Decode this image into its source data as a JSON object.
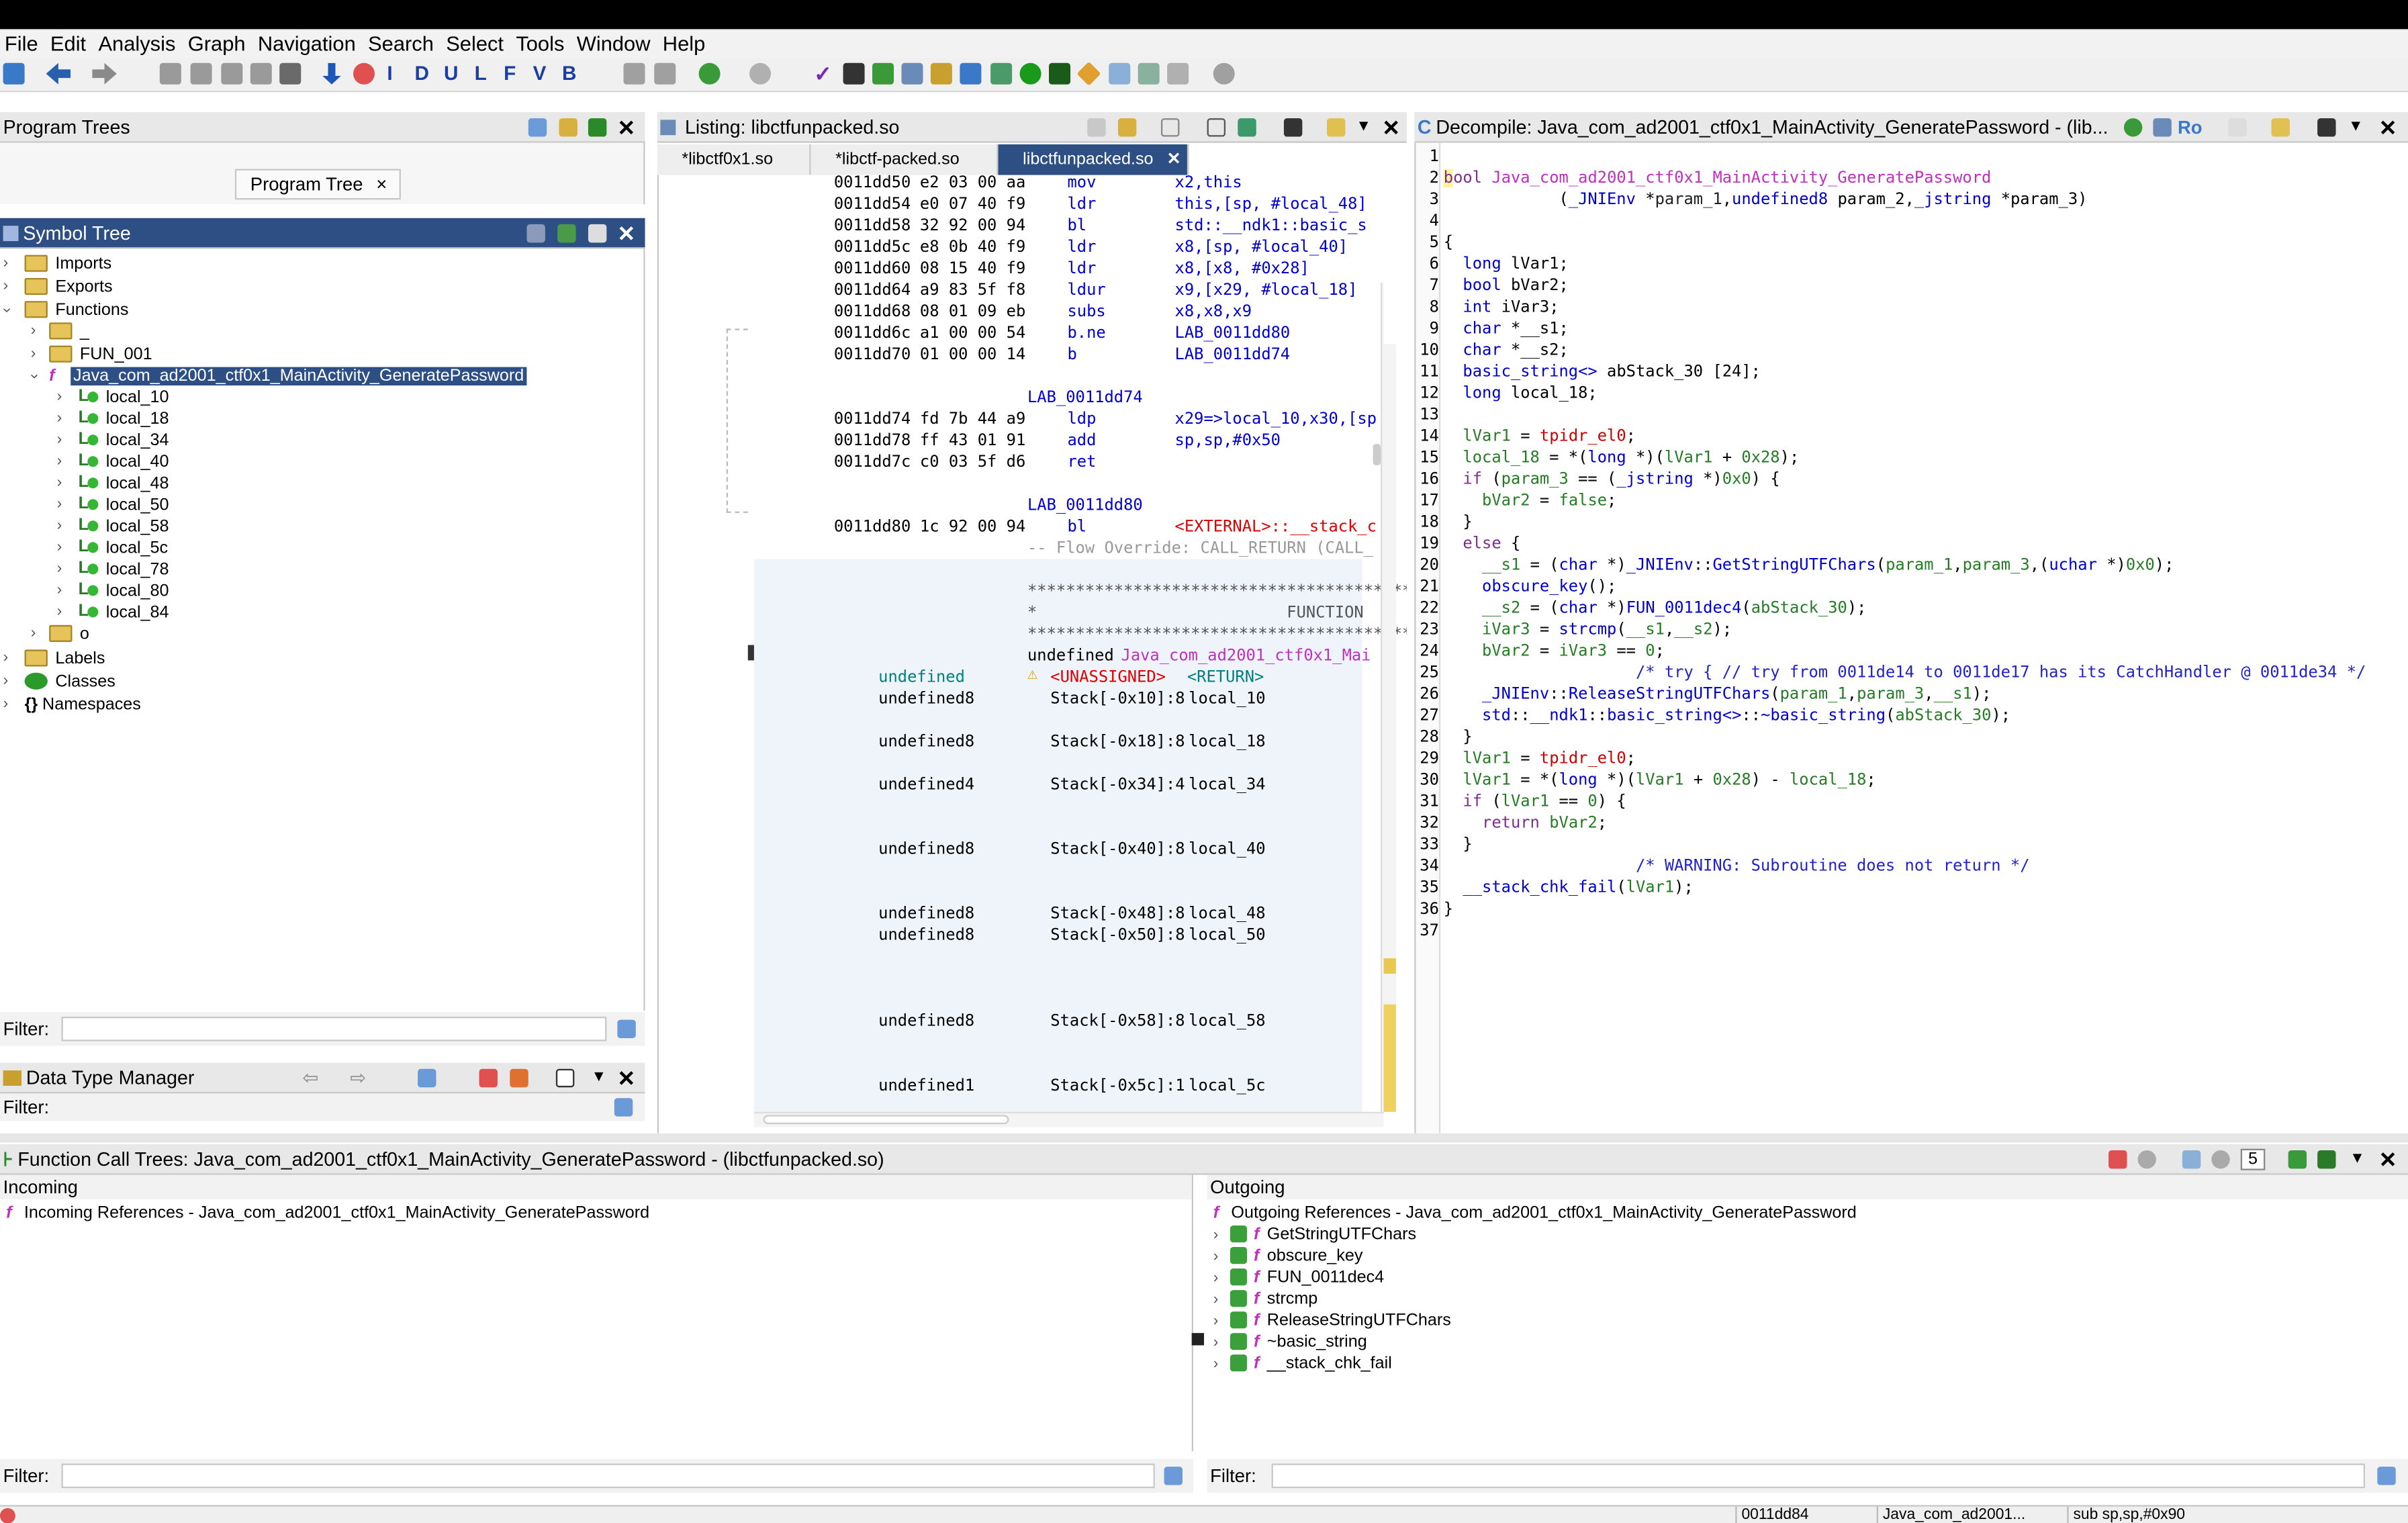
{
  "menu": [
    "File",
    "Edit",
    "Analysis",
    "Graph",
    "Navigation",
    "Search",
    "Select",
    "Tools",
    "Window",
    "Help"
  ],
  "program_trees": {
    "title": "Program Trees",
    "tab": "Program Tree",
    "close_glyph": "×"
  },
  "symbol_tree": {
    "title": "Symbol Tree",
    "imports": "Imports",
    "exports": "Exports",
    "functions": "Functions",
    "underscore": "_",
    "fun001": "FUN_001",
    "selected_function": "Java_com_ad2001_ctf0x1_MainActivity_GeneratePassword",
    "locals": [
      "local_10",
      "local_18",
      "local_34",
      "local_40",
      "local_48",
      "local_50",
      "local_58",
      "local_5c",
      "local_78",
      "local_80",
      "local_84"
    ],
    "o_node": "o",
    "labels": "Labels",
    "classes": "Classes",
    "namespaces": "Namespaces",
    "filter_label": "Filter:"
  },
  "data_type_manager": {
    "title": "Data Type Manager",
    "filter_label": "Filter:"
  },
  "listing": {
    "title": "Listing:  libctfunpacked.so",
    "tabs": [
      "*libctf0x1.so",
      "*libctf-packed.so",
      "libctfunpacked.so"
    ],
    "asm": [
      {
        "addr": "0011dd50",
        "bytes": "e2 03 00 aa",
        "mn": "mov",
        "op": "x2,this"
      },
      {
        "addr": "0011dd54",
        "bytes": "e0 07 40 f9",
        "mn": "ldr",
        "op": "this,[sp, #local_48]"
      },
      {
        "addr": "0011dd58",
        "bytes": "32 92 00 94",
        "mn": "bl",
        "op": "std::__ndk1::basic_s"
      },
      {
        "addr": "0011dd5c",
        "bytes": "e8 0b 40 f9",
        "mn": "ldr",
        "op": "x8,[sp, #local_40]"
      },
      {
        "addr": "0011dd60",
        "bytes": "08 15 40 f9",
        "mn": "ldr",
        "op": "x8,[x8, #0x28]"
      },
      {
        "addr": "0011dd64",
        "bytes": "a9 83 5f f8",
        "mn": "ldur",
        "op": "x9,[x29, #local_18]"
      },
      {
        "addr": "0011dd68",
        "bytes": "08 01 09 eb",
        "mn": "subs",
        "op": "x8,x8,x9"
      },
      {
        "addr": "0011dd6c",
        "bytes": "a1 00 00 54",
        "mn": "b.ne",
        "op": "LAB_0011dd80"
      },
      {
        "addr": "0011dd70",
        "bytes": "01 00 00 14",
        "mn": "b",
        "op": "LAB_0011dd74"
      }
    ],
    "label1": "LAB_0011dd74",
    "asm2": [
      {
        "addr": "0011dd74",
        "bytes": "fd 7b 44 a9",
        "mn": "ldp",
        "op": "x29=>local_10,x30,[sp"
      },
      {
        "addr": "0011dd78",
        "bytes": "ff 43 01 91",
        "mn": "add",
        "op": "sp,sp,#0x50"
      },
      {
        "addr": "0011dd7c",
        "bytes": "c0 03 5f d6",
        "mn": "ret",
        "op": ""
      }
    ],
    "label2": "LAB_0011dd80",
    "asm3": {
      "addr": "0011dd80",
      "bytes": "1c 92 00 94",
      "mn": "bl",
      "op": "<EXTERNAL>::__stack_c"
    },
    "flow": "-- Flow Override: CALL_RETURN (CALL_",
    "stars": "****************************************",
    "star_fn": "*                          FUNCTION",
    "sig_type": "undefined",
    "sig_name": "Java_com_ad2001_ctf0x1_Mai",
    "ret_type": "undefined",
    "unassigned": "<UNASSIGNED>",
    "ret": "<RETURN>",
    "vars": [
      {
        "t": "undefined8",
        "s": "Stack[-0x10]:8",
        "n": "local_10"
      },
      {
        "t": "undefined8",
        "s": "Stack[-0x18]:8",
        "n": "local_18"
      },
      {
        "t": "undefined4",
        "s": "Stack[-0x34]:4",
        "n": "local_34"
      },
      {
        "t": "undefined8",
        "s": "Stack[-0x40]:8",
        "n": "local_40"
      },
      {
        "t": "undefined8",
        "s": "Stack[-0x48]:8",
        "n": "local_48"
      },
      {
        "t": "undefined8",
        "s": "Stack[-0x50]:8",
        "n": "local_50"
      },
      {
        "t": "undefined8",
        "s": "Stack[-0x58]:8",
        "n": "local_58"
      },
      {
        "t": "undefined1",
        "s": "Stack[-0x5c]:1",
        "n": "local_5c"
      }
    ]
  },
  "decompile": {
    "title": "Decompile: Java_com_ad2001_ctf0x1_MainActivity_GeneratePassword -  (lib...",
    "ro": "Ro",
    "line_numbers": [
      "1",
      "2",
      "3",
      "4",
      "5",
      "6",
      "7",
      "8",
      "9",
      "10",
      "11",
      "12",
      "13",
      "14",
      "15",
      "16",
      "17",
      "18",
      "19",
      "20",
      "21",
      "22",
      "23",
      "24",
      "25",
      "26",
      "27",
      "28",
      "29",
      "30",
      "31",
      "32",
      "33",
      "34",
      "35",
      "36",
      "37"
    ]
  },
  "call_trees": {
    "title": "Function Call Trees: Java_com_ad2001_ctf0x1_MainActivity_GeneratePassword -  (libctfunpacked.so)",
    "incoming": "Incoming",
    "outgoing": "Outgoing",
    "incoming_ref": "Incoming References - Java_com_ad2001_ctf0x1_MainActivity_GeneratePassword",
    "outgoing_ref": "Outgoing References - Java_com_ad2001_ctf0x1_MainActivity_GeneratePassword",
    "outgoing_items": [
      "GetStringUTFChars",
      "obscure_key",
      "FUN_0011dec4",
      "strcmp",
      "ReleaseStringUTFChars",
      "~basic_string",
      "__stack_chk_fail"
    ],
    "depth": "5",
    "filter_label": "Filter:"
  },
  "status": {
    "addr": "0011dd84",
    "fn": "Java_com_ad2001...",
    "instr": "sub sp,sp,#0x90"
  }
}
